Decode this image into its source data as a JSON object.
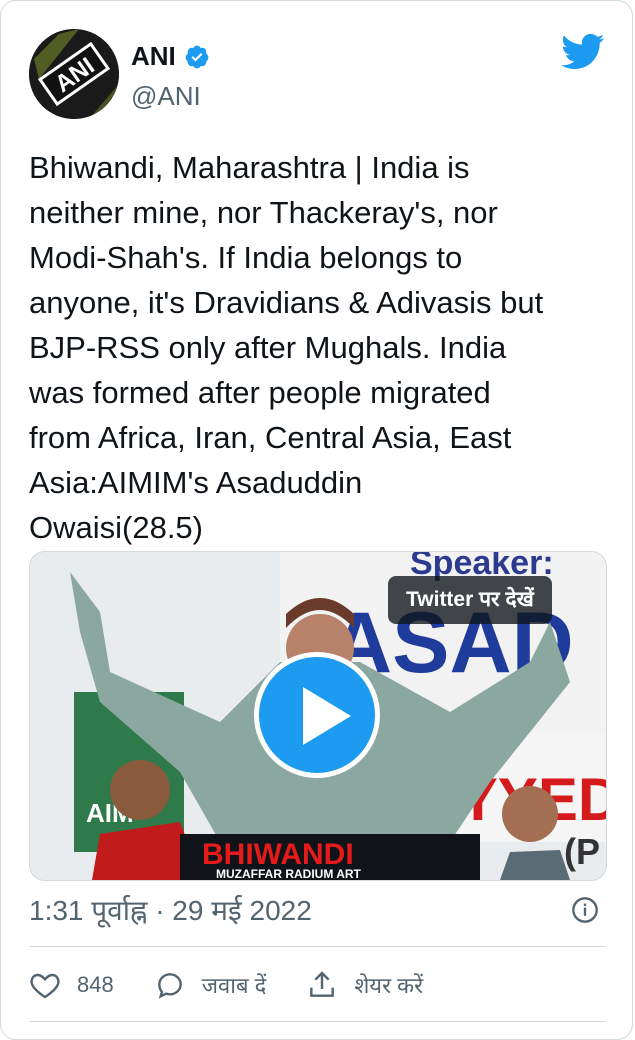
{
  "author": {
    "name": "ANI",
    "handle": "@ANI",
    "avatar_text": "ANI",
    "verified": true
  },
  "tweet": {
    "text": "Bhiwandi, Maharashtra | India is\nneither mine, nor Thackeray's, nor\nModi-Shah's. If India belongs to\nanyone, it's Dravidians & Adivasis but\nBJP-RSS only after Mughals. India\nwas formed after people migrated\nfrom Africa, Iran, Central Asia, East\nAsia:AIMIM's Asaduddin\nOwaisi(28.5)"
  },
  "media": {
    "watch_on_twitter": "Twitter पर देखें",
    "banner_top": "Speaker:",
    "banner_name": "ASAD",
    "banner_name2": "AYYED",
    "banner_side": "(P",
    "podium_title": "BHIWANDI",
    "podium_sub": "MUZAFFAR RADIUM ART",
    "left_sign": "AIM"
  },
  "meta": {
    "timestamp": "1:31 पूर्वाह्न · 29 मई 2022"
  },
  "actions": {
    "likes": "848",
    "reply_label": "जवाब दें",
    "share_label": "शेयर करें"
  },
  "colors": {
    "brand_blue": "#1d9bf0",
    "muted_text": "#536471",
    "text": "#0f1419",
    "border": "#cfd9de"
  }
}
